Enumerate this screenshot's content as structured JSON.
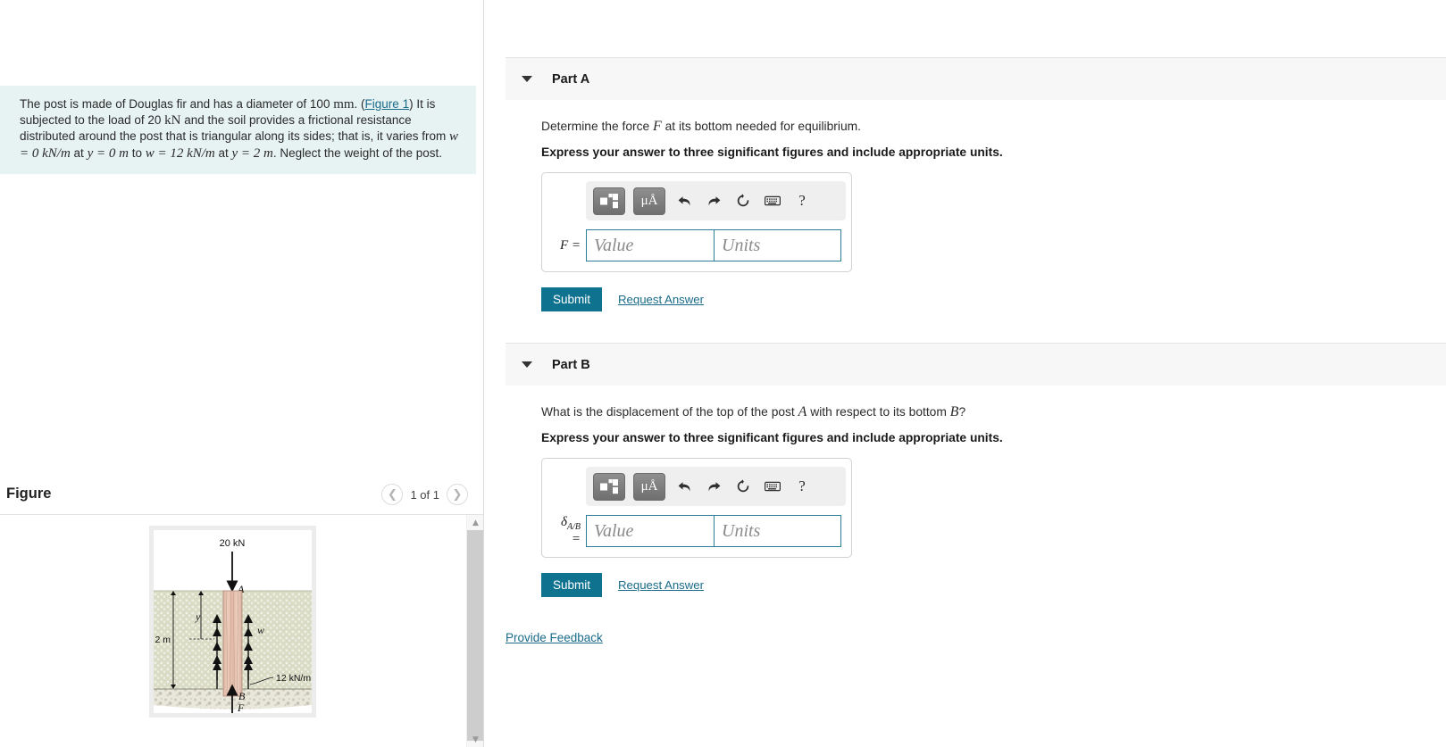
{
  "problem": {
    "line1_a": "The post is made of Douglas fir and has a diameter of 100 ",
    "line1_mm": "mm",
    "line1_b": ". (",
    "figure_link": "Figure 1",
    "line1_c": ") It is subjected to the load of 20 ",
    "line1_kn": "kN",
    "line1_d": " and the soil provides a frictional resistance distributed around the post that is triangular along its sides; that is, it varies from ",
    "eq1": "w = 0 kN/m",
    "at1": " at ",
    "eq2": "y = 0 m",
    "to": " to ",
    "eq3": "w = 12 kN/m",
    "at2": " at ",
    "eq4": "y = 2 m",
    "tail": ". Neglect the weight of the post."
  },
  "figure_panel": {
    "title": "Figure",
    "counter": "1 of 1",
    "prev_icon": "chevron-left-icon",
    "next_icon": "chevron-right-icon",
    "scroll_up_icon": "caret-up-icon",
    "scroll_down_icon": "caret-down-icon"
  },
  "figure_diagram": {
    "load_label": "20 kN",
    "point_a": "A",
    "point_b": "B",
    "depth_label": "2 m",
    "y_label": "y",
    "w_label": "w",
    "w_max_label": "12 kN/m",
    "reaction_label": "F",
    "colors": {
      "soil": "#d8dac2",
      "soil_speckle": "#ecefe2",
      "gravel": "#e6e5d8",
      "post": "#e3b9a7",
      "post_grain": "#c59b8a",
      "outline": "#1a1a1a"
    }
  },
  "parts": [
    {
      "id": "part-a",
      "label": "Part A",
      "caret_icon": "caret-down-icon",
      "question_pre": "Determine the force ",
      "question_sym": "F",
      "question_post": " at its bottom needed for equilibrium.",
      "instruction": "Express your answer to three significant figures and include appropriate units.",
      "field_label": "F =",
      "value_placeholder": "Value",
      "units_placeholder": "Units",
      "submit_label": "Submit",
      "request_label": "Request Answer",
      "toolbar": {
        "template_icon": "math-template-icon",
        "units_icon": "micro-angstrom-units-icon",
        "units_text": "μÅ",
        "undo_icon": "undo-icon",
        "redo_icon": "redo-icon",
        "reset_icon": "reset-icon",
        "keyboard_icon": "keyboard-icon",
        "help_icon": "help-icon",
        "help_text": "?"
      }
    },
    {
      "id": "part-b",
      "label": "Part B",
      "caret_icon": "caret-down-icon",
      "question_pre": "What is the displacement of the top of the post ",
      "question_sym": "A",
      "question_mid": " with respect to its bottom ",
      "question_sym2": "B",
      "question_post": "?",
      "instruction": "Express your answer to three significant figures and include appropriate units.",
      "field_label_main": "δ",
      "field_label_sub": "A/B",
      "field_label_eq": " =",
      "value_placeholder": "Value",
      "units_placeholder": "Units",
      "submit_label": "Submit",
      "request_label": "Request Answer",
      "toolbar": {
        "template_icon": "math-template-icon",
        "units_icon": "micro-angstrom-units-icon",
        "units_text": "μÅ",
        "undo_icon": "undo-icon",
        "redo_icon": "redo-icon",
        "reset_icon": "reset-icon",
        "keyboard_icon": "keyboard-icon",
        "help_icon": "help-icon",
        "help_text": "?"
      }
    }
  ],
  "footer": {
    "feedback_label": "Provide Feedback"
  },
  "colors": {
    "accent": "#0f7390",
    "link": "#1a6b8a",
    "problem_bg": "#e7f2f2",
    "header_bg": "#f7f7f7",
    "input_border": "#2c7f99"
  }
}
